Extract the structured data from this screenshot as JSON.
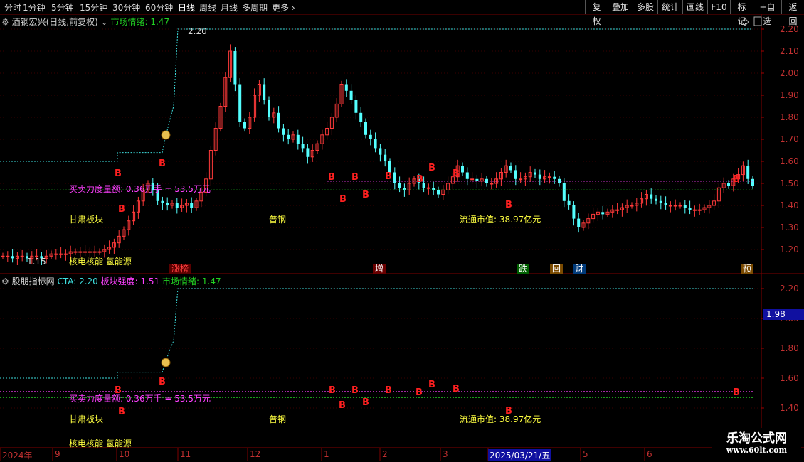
{
  "toolbar": {
    "periods": [
      "分时",
      "1分钟",
      "5分钟",
      "15分钟",
      "30分钟",
      "60分钟",
      "日线",
      "周线",
      "月线",
      "多周期",
      "更多"
    ],
    "active_period": "日线",
    "right_buttons": [
      "复权",
      "叠加",
      "多股",
      "统计",
      "画线",
      "F10",
      "标记",
      "+自选",
      "返回"
    ]
  },
  "top_pane": {
    "title": "酒钢宏兴(日线,前复权)",
    "market_label": "市场情绪: 1.47",
    "max_label": "2.20",
    "min_label": "1.15",
    "texts": {
      "buy_sell": "买卖力度量额: 0.36万手 = 53.5万元",
      "sector1": "甘肃板块",
      "sector2": "普钢",
      "mcap": "流通市值: 38.97亿元",
      "sector3": "核电核能 氢能源"
    },
    "tags": [
      {
        "text": "涨榜",
        "color": "#ff4040",
        "bg": "#5a0000"
      },
      {
        "text": "增",
        "color": "#ffffff",
        "bg": "#6a0000"
      },
      {
        "text": "跌",
        "color": "#ffffff",
        "bg": "#006000"
      },
      {
        "text": "回",
        "color": "#ffffff",
        "bg": "#7a4a00"
      },
      {
        "text": "财",
        "color": "#ffffff",
        "bg": "#003a7a"
      },
      {
        "text": "预",
        "color": "#ffffff",
        "bg": "#7a4a00"
      }
    ],
    "y_ticks": [
      "2.20",
      "2.10",
      "2.00",
      "1.90",
      "1.80",
      "1.70",
      "1.60",
      "1.50",
      "1.40",
      "1.30",
      "1.20"
    ]
  },
  "bottom_pane": {
    "title": "股朋指标网",
    "cta_label": "CTA: 2.20",
    "strength_label": "板块强度: 1.51",
    "market_label": "市场情绪: 1.47",
    "texts": {
      "buy_sell": "买卖力度量额: 0.36万手 = 53.5万元",
      "sector1": "甘肃板块",
      "sector2": "普钢",
      "mcap": "流通市值: 38.97亿元",
      "sector3": "核电核能 氢能源"
    },
    "current_value": "1.98",
    "y_ticks": [
      "2.20",
      "2.00",
      "1.80",
      "1.60",
      "1.40"
    ]
  },
  "time_axis": {
    "labels": [
      "2024年",
      "9",
      "10",
      "11",
      "12",
      "1",
      "2",
      "3",
      "2025/03/21/五",
      "5",
      "6"
    ]
  },
  "watermark": {
    "line1": "乐淘公式网",
    "line2": "www.60lt.com"
  },
  "chart_data": {
    "type": "candlestick",
    "title": "酒钢宏兴(日线,前复权)",
    "ylim": [
      1.15,
      2.25
    ],
    "close_series": [
      1.17,
      1.17,
      1.16,
      1.17,
      1.17,
      1.16,
      1.17,
      1.17,
      1.16,
      1.17,
      1.18,
      1.18,
      1.18,
      1.18,
      1.19,
      1.19,
      1.19,
      1.19,
      1.19,
      1.19,
      1.19,
      1.2,
      1.21,
      1.23,
      1.26,
      1.29,
      1.33,
      1.37,
      1.42,
      1.47,
      1.5,
      1.47,
      1.42,
      1.41,
      1.4,
      1.41,
      1.39,
      1.4,
      1.41,
      1.39,
      1.42,
      1.46,
      1.52,
      1.65,
      1.75,
      1.85,
      1.98,
      2.1,
      1.95,
      1.78,
      1.75,
      1.8,
      1.9,
      1.95,
      1.88,
      1.8,
      1.82,
      1.75,
      1.72,
      1.7,
      1.72,
      1.68,
      1.66,
      1.62,
      1.65,
      1.68,
      1.72,
      1.75,
      1.8,
      1.86,
      1.95,
      1.92,
      1.88,
      1.82,
      1.78,
      1.72,
      1.7,
      1.66,
      1.63,
      1.6,
      1.55,
      1.5,
      1.48,
      1.47,
      1.5,
      1.52,
      1.5,
      1.48,
      1.48,
      1.47,
      1.45,
      1.47,
      1.5,
      1.53,
      1.58,
      1.55,
      1.52,
      1.52,
      1.51,
      1.52,
      1.5,
      1.5,
      1.52,
      1.55,
      1.58,
      1.56,
      1.52,
      1.52,
      1.53,
      1.55,
      1.54,
      1.52,
      1.53,
      1.53,
      1.52,
      1.5,
      1.42,
      1.4,
      1.34,
      1.3,
      1.32,
      1.34,
      1.36,
      1.37,
      1.36,
      1.37,
      1.38,
      1.38,
      1.39,
      1.4,
      1.4,
      1.41,
      1.43,
      1.45,
      1.43,
      1.42,
      1.41,
      1.4,
      1.4,
      1.4,
      1.4,
      1.39,
      1.38,
      1.38,
      1.38,
      1.39,
      1.4,
      1.42,
      1.48,
      1.5,
      1.49,
      1.52,
      1.54,
      1.58,
      1.52,
      1.49
    ],
    "hlines": [
      {
        "name": "市场情绪",
        "value": 1.47,
        "color": "#22d022"
      },
      {
        "name": "CTA",
        "value": 2.2,
        "color": "#3ee0e0"
      },
      {
        "name": "板块强度",
        "value": 1.51,
        "color": "#ff40ff"
      }
    ],
    "bottom_ylim": [
      1.35,
      2.25
    ],
    "current_value": 1.98
  }
}
